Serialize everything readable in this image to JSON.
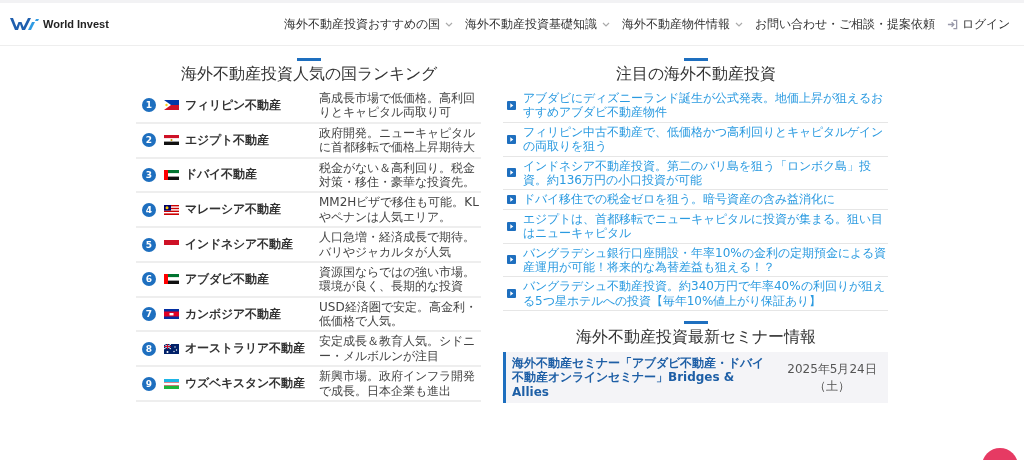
{
  "header": {
    "logo_text": "World Invest",
    "nav": [
      {
        "label": "海外不動産投資おすすめの国",
        "dropdown": true
      },
      {
        "label": "海外不動産投資基礎知識",
        "dropdown": true
      },
      {
        "label": "海外不動産物件情報",
        "dropdown": true
      },
      {
        "label": "お問い合わせ・ご相談・提案依頼",
        "dropdown": false
      }
    ],
    "login": "ログイン"
  },
  "ranking": {
    "title": "海外不動産投資人気の国ランキング",
    "rows": [
      {
        "rank": "1",
        "kind": "philippines",
        "name": "フィリピン不動産",
        "description": "高成長市場で低価格。高利回りとキャピタル両取り可"
      },
      {
        "rank": "2",
        "kind": "egypt",
        "name": "エジプト不動産",
        "description": "政府開発。ニューキャピタルに首都移転で価格上昇期待大"
      },
      {
        "rank": "3",
        "kind": "emirates",
        "name": "ドバイ不動産",
        "description": "税金がない＆高利回り。税金対策・移住・豪華な投資先。"
      },
      {
        "rank": "4",
        "kind": "malaysia",
        "name": "マレーシア不動産",
        "description": "MM2Hビザで移住も可能。KLやペナンは人気エリア。"
      },
      {
        "rank": "5",
        "kind": "indonesia",
        "name": "インドネシア不動産",
        "description": "人口急増・経済成長で期待。バリやジャカルタが人気"
      },
      {
        "rank": "6",
        "kind": "emirates",
        "name": "アブダビ不動産",
        "description": "資源国ならではの強い市場。環境が良く、長期的な投資"
      },
      {
        "rank": "7",
        "kind": "cambodia",
        "name": "カンボジア不動産",
        "description": "USD経済圏で安定。高金利・低価格で人気。"
      },
      {
        "rank": "8",
        "kind": "australia",
        "name": "オーストラリア不動産",
        "description": "安定成長＆教育人気。シドニー・メルボルンが注目"
      },
      {
        "rank": "9",
        "kind": "uzbekistan",
        "name": "ウズベキスタン不動産",
        "description": "新興市場。政府インフラ開発で成長。日本企業も進出"
      }
    ]
  },
  "featured": {
    "title": "注目の海外不動産投資",
    "links": [
      "アブダビにディズニーランド誕生が公式発表。地価上昇が狙えるおすすめアブダビ不動産物件",
      "フィリピン中古不動産で、低価格かつ高利回りとキャピタルゲインの両取りを狙う",
      "インドネシア不動産投資。第二のバリ島を狙う「ロンボク島」投資。約136万円の小口投資が可能",
      "ドバイ移住での税金ゼロを狙う。暗号資産の含み益消化に",
      "エジプトは、首都移転でニューキャピタルに投資が集まる。狙い目はニューキャピタル",
      "バングラデシュ銀行口座開設・年率10%の金利の定期預金による資産運用が可能！将来的な為替差益も狙える！？",
      "バングラデシュ不動産投資。約340万円で年率40%の利回りが狙える5つ星ホテルへの投資【毎年10%値上がり保証あり】"
    ]
  },
  "seminars": {
    "title": "海外不動産投資最新セミナー情報",
    "items": [
      {
        "title": "海外不動産セミナー「アブダビ不動産・ドバイ不動産オンラインセミナー」Bridges & Allies",
        "date": "2025年5月24日（土）"
      }
    ]
  }
}
